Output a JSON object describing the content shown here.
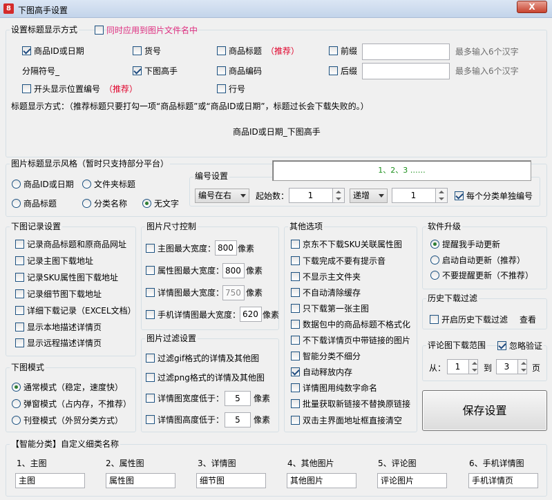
{
  "window": {
    "title": "下图高手设置",
    "close_label": "X",
    "app_icon": "8"
  },
  "title_settings": {
    "legend": "设置标题显示方式",
    "apply_label": "同时应用到图片文件名中",
    "items": {
      "product_id": "商品ID或日期",
      "goods_no": "货号",
      "product_title": "商品标题",
      "recommend": "（推荐）",
      "prefix": "前缀",
      "separator": "分隔符号_",
      "xiatu": "下图高手",
      "product_code": "商品编码",
      "suffix": "后缀",
      "start_pos": "开头显示位置编号",
      "recommend2": "（推荐）",
      "line_no": "行号"
    },
    "prefix_value": "",
    "suffix_value": "",
    "limit_hint1": "最多输入6个汉字",
    "limit_hint2": "最多输入6个汉字",
    "note": "标题显示方式：（推荐标题只要打勾一项“商品标题”或“商品ID或日期”，标题过长会下载失败的。）",
    "result": "商品ID或日期_下图高手"
  },
  "image_title_style": {
    "legend": "图片标题显示风格（暂时只支持部分平台）",
    "options": [
      "商品ID或日期",
      "文件夹标题",
      "商品标题",
      "分类名称",
      "无文字"
    ],
    "selected": "无文字",
    "preview": "1、2、3 ……"
  },
  "numbering": {
    "legend": "编号设置",
    "position": "编号在右",
    "start_label": "起始数：",
    "start_value": "1",
    "mode": "递增",
    "step_value": "1",
    "per_category_label": "每个分类单独编号"
  },
  "download_log": {
    "legend": "下图记录设置",
    "items": [
      "记录商品标题和原商品网址",
      "记录主图下载地址",
      "记录SKU属性图下载地址",
      "记录细节图下载地址",
      "详细下载记录（EXCEL文档）",
      "显示本地描述详情页",
      "显示远程描述详情页"
    ]
  },
  "image_size": {
    "legend": "图片尺寸控制",
    "items": [
      {
        "label": "主图最大宽度：",
        "value": "800",
        "unit": "像素"
      },
      {
        "label": "属性图最大宽度：",
        "value": "800",
        "unit": "像素"
      },
      {
        "label": "详情图最大宽度：",
        "value": "750",
        "unit": "像素"
      },
      {
        "label": "手机详情图最大宽度：",
        "value": "620",
        "unit": "像素"
      }
    ]
  },
  "image_filter": {
    "legend": "图片过滤设置",
    "gif_label": "过滤gif格式的详情及其他图",
    "png_label": "过滤png格式的详情及其他图",
    "width_label": "详情图宽度低于：",
    "width_value": "5",
    "height_label": "详情图高度低于：",
    "height_value": "5",
    "unit": "像素"
  },
  "download_mode": {
    "legend": "下图模式",
    "options": [
      "通常模式（稳定，速度快）",
      "弹窗模式（占内存，不推荐）",
      "刊登模式（外贸分类方式）"
    ],
    "selected": "通常模式（稳定，速度快）"
  },
  "other_options": {
    "legend": "其他选项",
    "items": [
      {
        "label": "京东不下载SKU关联属性图",
        "checked": false
      },
      {
        "label": "下载完成不要有提示音",
        "checked": false
      },
      {
        "label": "不显示主文件夹",
        "checked": false
      },
      {
        "label": "不自动清除缓存",
        "checked": false
      },
      {
        "label": "只下载第一张主图",
        "checked": false
      },
      {
        "label": "数据包中的商品标题不格式化",
        "checked": false
      },
      {
        "label": "不下载详情页中带链接的图片",
        "checked": false
      },
      {
        "label": "智能分类不细分",
        "checked": false
      },
      {
        "label": "自动释放内存",
        "checked": true
      },
      {
        "label": "详情图用纯数字命名",
        "checked": false
      },
      {
        "label": "批量获取新链接不替换原链接",
        "checked": false
      },
      {
        "label": "双击主界面地址框直接清空",
        "checked": false
      }
    ]
  },
  "upgrade": {
    "legend": "软件升级",
    "options": [
      "提醒我手动更新",
      "启动自动更新（推荐）",
      "不要提醒更新（不推荐）"
    ],
    "selected": "提醒我手动更新"
  },
  "history_filter": {
    "legend": "历史下载过滤",
    "enable_label": "开启历史下载过滤",
    "view_label": "查看"
  },
  "comment_range": {
    "legend": "评论图下载范围",
    "ignore_label": "忽略验证",
    "from_label": "从：",
    "from_value": "1",
    "to_label": "到",
    "to_value": "3",
    "page_label": "页"
  },
  "save_label": "保存设置",
  "categories": {
    "legend": "【智能分类】自定义细类名称",
    "items": [
      {
        "label": "1、主图",
        "value": "主图"
      },
      {
        "label": "2、属性图",
        "value": "属性图"
      },
      {
        "label": "3、详情图",
        "value": "细节图"
      },
      {
        "label": "4、其他图片",
        "value": "其他图片"
      },
      {
        "label": "5、评论图",
        "value": "评论图片"
      },
      {
        "label": "6、手机详情图",
        "value": "手机详情页"
      }
    ]
  }
}
